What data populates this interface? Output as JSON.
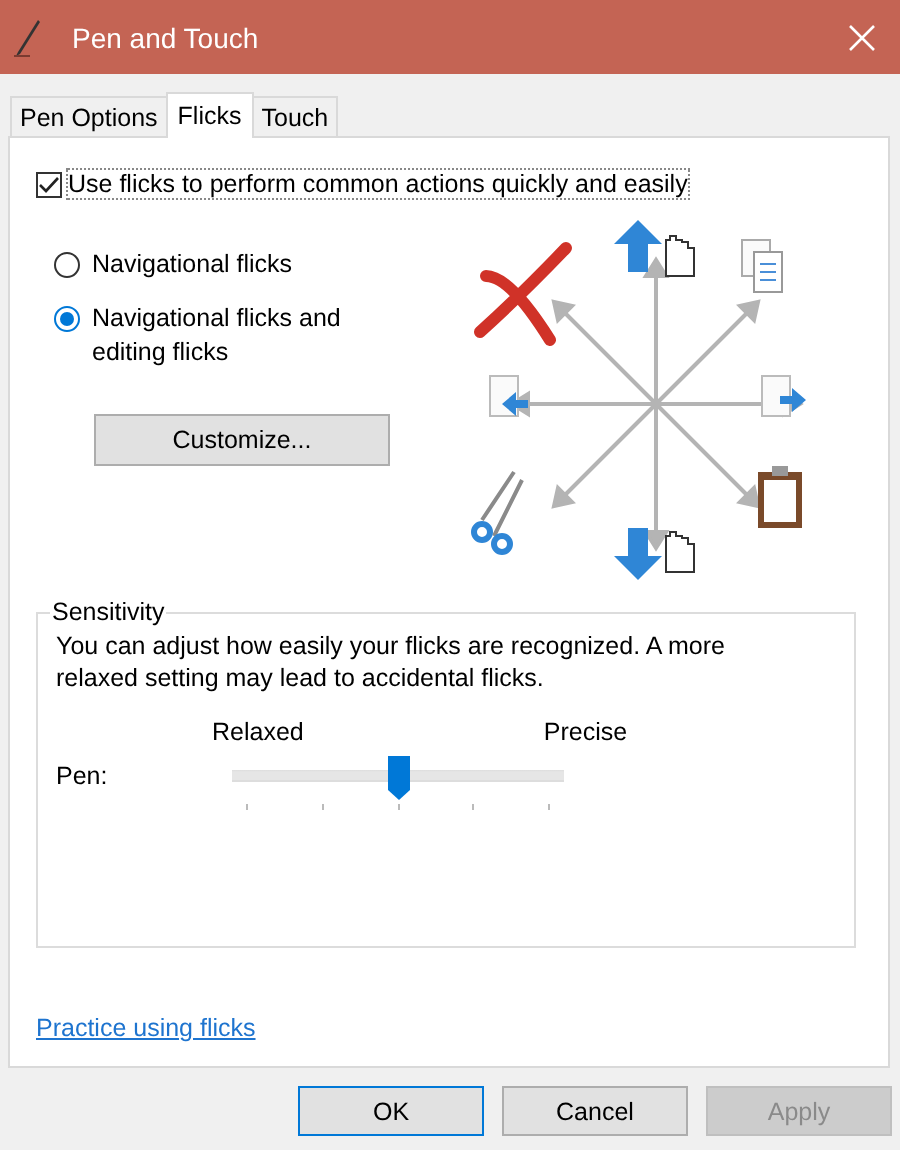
{
  "window": {
    "title": "Pen and Touch"
  },
  "tabs": [
    {
      "label": "Pen Options",
      "selected": false
    },
    {
      "label": "Flicks",
      "selected": true
    },
    {
      "label": "Touch",
      "selected": false
    }
  ],
  "use_flicks": {
    "label": "Use flicks to perform common actions quickly and easily",
    "checked": true
  },
  "flick_modes": [
    {
      "label": "Navigational flicks",
      "selected": false
    },
    {
      "label": "Navigational flicks and editing flicks",
      "selected": true
    }
  ],
  "customize_button": "Customize...",
  "sensitivity": {
    "title": "Sensitivity",
    "description": "You can adjust how easily your flicks are recognized. A more relaxed setting may lead to accidental flicks.",
    "low_label": "Relaxed",
    "high_label": "Precise",
    "slider_label": "Pen:",
    "level": 0.5
  },
  "practice_link": "Practice using flicks",
  "buttons": [
    {
      "label": "OK",
      "disabled": false,
      "default": true
    },
    {
      "label": "Cancel",
      "disabled": false,
      "default": false
    },
    {
      "label": "Apply",
      "disabled": true,
      "default": false
    }
  ]
}
